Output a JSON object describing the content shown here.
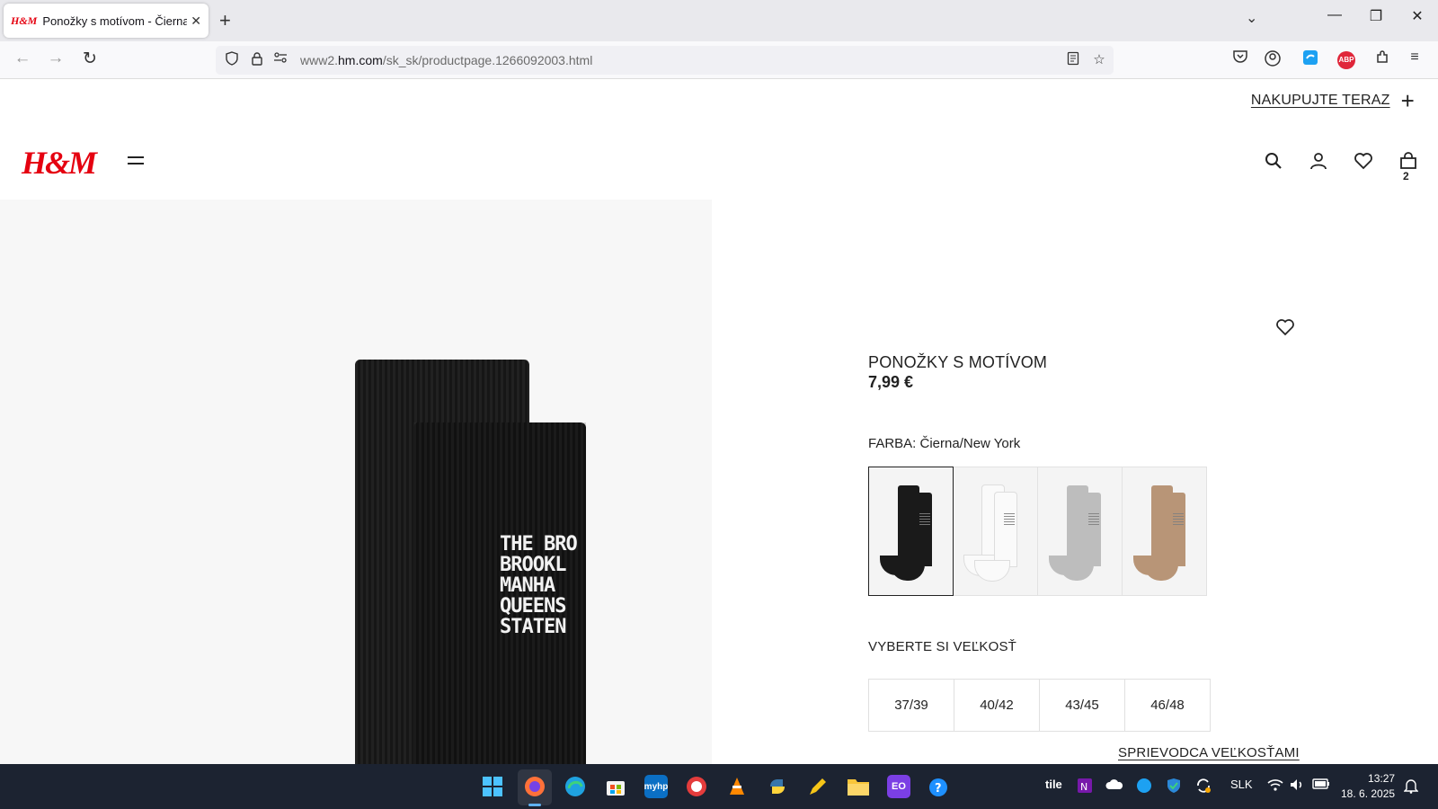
{
  "browser": {
    "tab_title": "Ponožky s motívom - Čierna/New York",
    "tab_favicon": "H&M",
    "url_prefix": "www2.",
    "url_domain": "hm.com",
    "url_path": "/sk_sk/productpage.1266092003.html"
  },
  "header": {
    "promo_label": "NAKUPUJTE TERAZ",
    "logo": "H&M",
    "bag_count": "2"
  },
  "product": {
    "name": "PONOŽKY S MOTÍVOM",
    "price": "7,99 €",
    "color_label": "FARBA: Čierna/New York",
    "image_print": "THE BRO\nBROOKL\nMANHA\nQUEENS\nSTATEN",
    "swatches": [
      {
        "color": "#1a1a1a",
        "selected": true
      },
      {
        "color": "#f3f3f3",
        "selected": false
      },
      {
        "color": "#bdbdbd",
        "selected": false
      },
      {
        "color": "#b89577",
        "selected": false
      }
    ],
    "size_label": "VYBERTE SI VEĽKOSŤ",
    "sizes": [
      "37/39",
      "40/42",
      "43/45",
      "46/48"
    ],
    "size_guide": "SPRIEVODCA VEĽKOSŤAMI"
  },
  "taskbar": {
    "tray_tile": "tile",
    "language": "SLK",
    "time": "13:27",
    "date": "18. 6. 2025"
  },
  "colors": {
    "brand": "#e50010",
    "taskbar": "#1c2331"
  }
}
